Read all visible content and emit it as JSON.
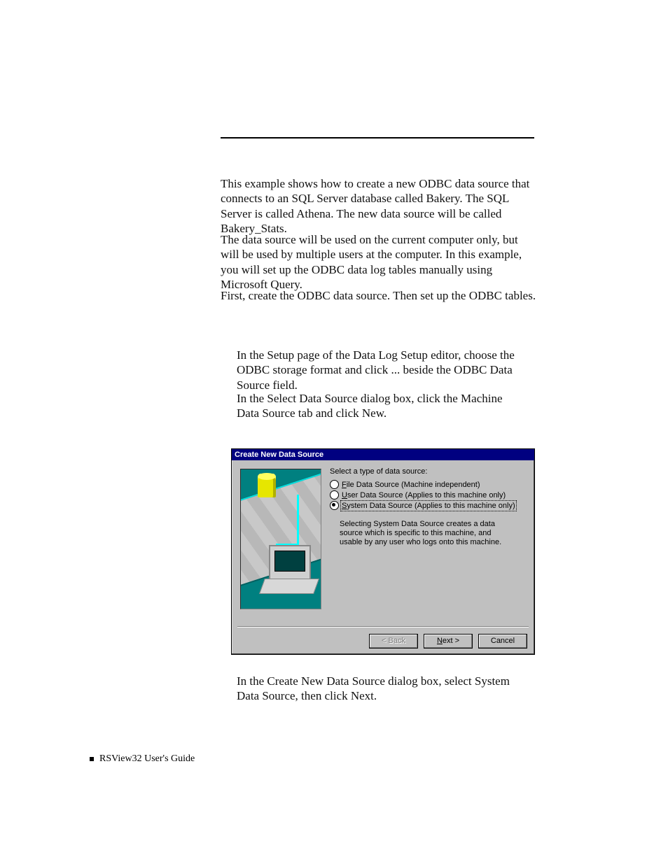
{
  "paragraphs": {
    "p1": "This example shows how to create a new ODBC data source that connects to an SQL Server database called Bakery. The SQL Server is called Athena. The new data source will be called Bakery_Stats.",
    "p2": "The data source will be used on the current computer only, but will be used by multiple users at the computer. In this example, you will set up the ODBC data log tables manually using Microsoft Query.",
    "p3": "First, create the ODBC data source. Then set up the ODBC tables."
  },
  "steps": {
    "s1": "In the Setup page of the Data Log Setup editor, choose the ODBC storage format and click ... beside the ODBC Data Source field.",
    "s2": "In the Select Data Source dialog box, click the Machine Data Source tab and click New.",
    "s3": "In the Create New Data Source dialog box, select System Data Source, then click Next."
  },
  "dialog": {
    "title": "Create New Data Source",
    "prompt": "Select a type of data source:",
    "options": {
      "file": "File Data Source (Machine independent)",
      "user": "User Data Source (Applies to this machine only)",
      "system": "System Data Source (Applies to this machine only)"
    },
    "selected": "system",
    "description": "Selecting System Data Source creates a data source which is specific to this machine, and usable by any user who logs onto this machine.",
    "buttons": {
      "back_label": "< Back",
      "next_prefix": "N",
      "next_rest": "ext >",
      "cancel_label": "Cancel"
    }
  },
  "footer": "RSView32  User's Guide"
}
